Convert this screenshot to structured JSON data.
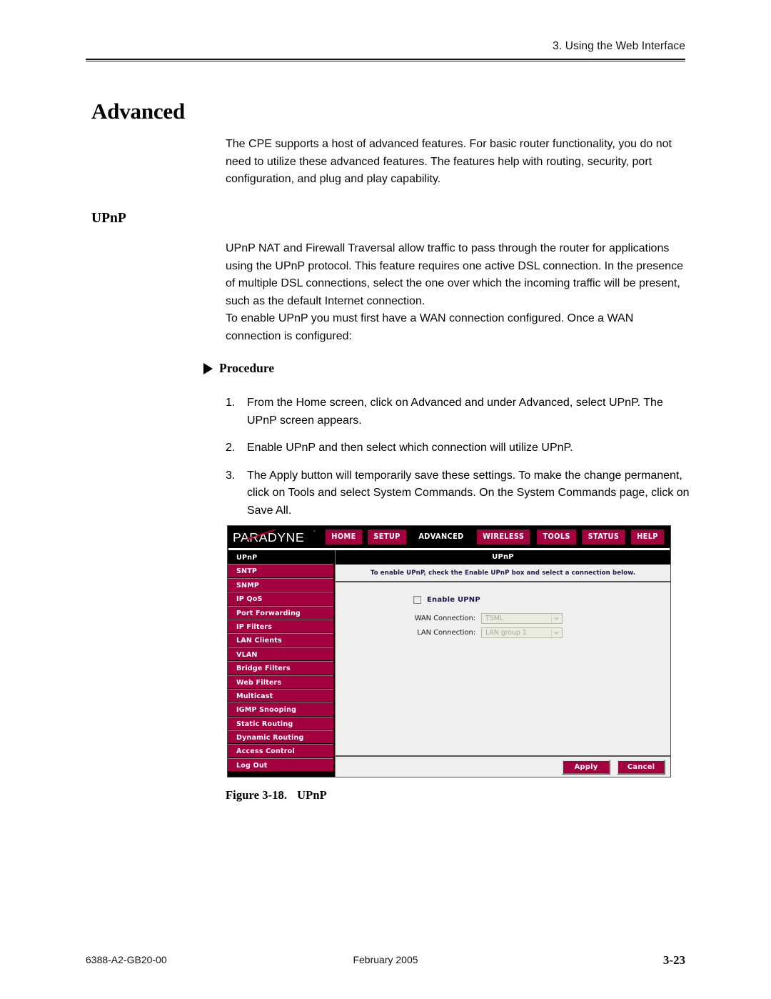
{
  "page": {
    "running_head": "3. Using the Web Interface",
    "heading": "Advanced",
    "intro_paragraph": "The CPE supports a host of advanced features. For basic router functionality, you do not need to utilize these advanced features. The features help with routing, security, port configuration, and plug and play capability.",
    "section_heading": "UPnP",
    "upnp_paragraph_1": "UPnP NAT and Firewall Traversal allow traffic to pass through the router for applications using the UPnP protocol. This feature requires one active DSL connection. In the presence of multiple DSL connections, select the one over which the incoming traffic will be present, such as the default Internet connection.",
    "upnp_paragraph_2": "To enable UPnP you must first have a WAN connection configured. Once a WAN connection is configured:",
    "procedure_label": "Procedure",
    "steps": [
      {
        "num": "1.",
        "text": "From the Home screen, click on Advanced and under Advanced, select UPnP. The UPnP screen appears."
      },
      {
        "num": "2.",
        "text": "Enable UPnP and then select which connection will utilize UPnP."
      },
      {
        "num": "3.",
        "text": "The Apply button will temporarily save these settings. To make the change permanent, click on Tools and select System Commands. On the System Commands page, click on Save All."
      }
    ],
    "figure_caption_label": "Figure 3-18.",
    "figure_caption_title": "UPnP",
    "footer": {
      "document_number": "6388-A2-GB20-00",
      "date": "February 2005",
      "page_number": "3-23"
    }
  },
  "router_ui": {
    "logo": "PARADYNE",
    "logo_tm": "™",
    "nav_tabs": [
      {
        "label": "HOME",
        "active": false
      },
      {
        "label": "SETUP",
        "active": false
      },
      {
        "label": "ADVANCED",
        "active": true
      },
      {
        "label": "WIRELESS",
        "active": false
      },
      {
        "label": "TOOLS",
        "active": false
      },
      {
        "label": "STATUS",
        "active": false
      },
      {
        "label": "HELP",
        "active": false
      }
    ],
    "sidebar": [
      {
        "label": "UPnP",
        "active": true
      },
      {
        "label": "SNTP",
        "active": false
      },
      {
        "label": "SNMP",
        "active": false
      },
      {
        "label": "IP QoS",
        "active": false
      },
      {
        "label": "Port Forwarding",
        "active": false
      },
      {
        "label": "IP Filters",
        "active": false
      },
      {
        "label": "LAN Clients",
        "active": false
      },
      {
        "label": "VLAN",
        "active": false
      },
      {
        "label": "Bridge Filters",
        "active": false
      },
      {
        "label": "Web Filters",
        "active": false
      },
      {
        "label": "Multicast",
        "active": false
      },
      {
        "label": "IGMP Snooping",
        "active": false
      },
      {
        "label": "Static Routing",
        "active": false
      },
      {
        "label": "Dynamic Routing",
        "active": false
      },
      {
        "label": "Access Control",
        "active": false
      },
      {
        "label": "Log Out",
        "active": false
      }
    ],
    "panel": {
      "title": "UPnP",
      "instruction": "To enable UPnP, check the Enable UPnP box and select a connection below.",
      "enable_checkbox_label": "Enable UPNP",
      "enable_checkbox_checked": false,
      "wan_label": "WAN Connection:",
      "wan_value": "TSML",
      "lan_label": "LAN Connection:",
      "lan_value": "LAN group 1",
      "apply_label": "Apply",
      "cancel_label": "Cancel"
    },
    "colors": {
      "brand_red": "#a30040",
      "nav_bar_black": "#000000",
      "panel_gray": "#efefef",
      "label_navy": "#1a1a4e"
    }
  }
}
